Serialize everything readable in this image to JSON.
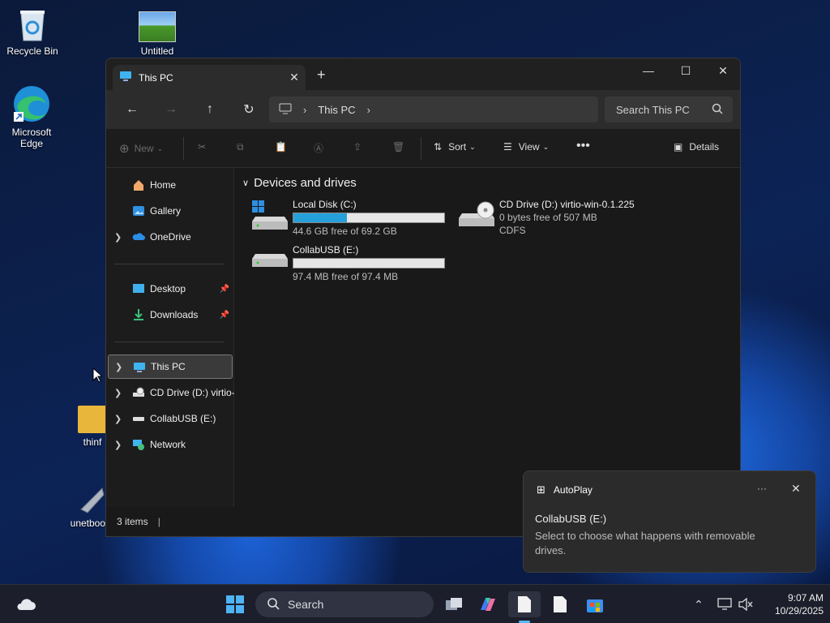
{
  "desktop": {
    "icons": [
      {
        "label": "Recycle Bin"
      },
      {
        "label": "Untitled"
      },
      {
        "label": "Microsoft Edge"
      },
      {
        "label": "thinf"
      },
      {
        "label": "unetboot"
      }
    ]
  },
  "explorer": {
    "tab_title": "This PC",
    "address": {
      "crumb": "This PC"
    },
    "search_placeholder": "Search This PC",
    "commands": {
      "new": "New",
      "sort": "Sort",
      "view": "View",
      "details": "Details"
    },
    "sidebar": {
      "quick": [
        "Home",
        "Gallery",
        "OneDrive"
      ],
      "pinned": [
        "Desktop",
        "Downloads"
      ],
      "tree": [
        "This PC",
        "CD Drive (D:) virtio-",
        "CollabUSB (E:)",
        "Network"
      ]
    },
    "group_header": "Devices and drives",
    "drives": [
      {
        "name": "Local Disk (C:)",
        "free_text": "44.6 GB free of 69.2 GB",
        "used_fraction": 0.355
      },
      {
        "name": "CD Drive (D:) virtio-win-0.1.225",
        "free_text": "0 bytes free of 507 MB",
        "fs": "CDFS"
      },
      {
        "name": "CollabUSB (E:)",
        "free_text": "97.4 MB free of 97.4 MB",
        "used_fraction": 0.0
      }
    ],
    "status": {
      "items": "3 items"
    }
  },
  "toast": {
    "app": "AutoPlay",
    "title": "CollabUSB (E:)",
    "body": "Select to choose what happens with removable drives."
  },
  "taskbar": {
    "search_label": "Search",
    "time": "9:07 AM",
    "date": "10/29/2025"
  },
  "colors": {
    "accent": "#26a0da",
    "window_bg": "#191919",
    "taskbar_bg": "#1c1f2b"
  }
}
